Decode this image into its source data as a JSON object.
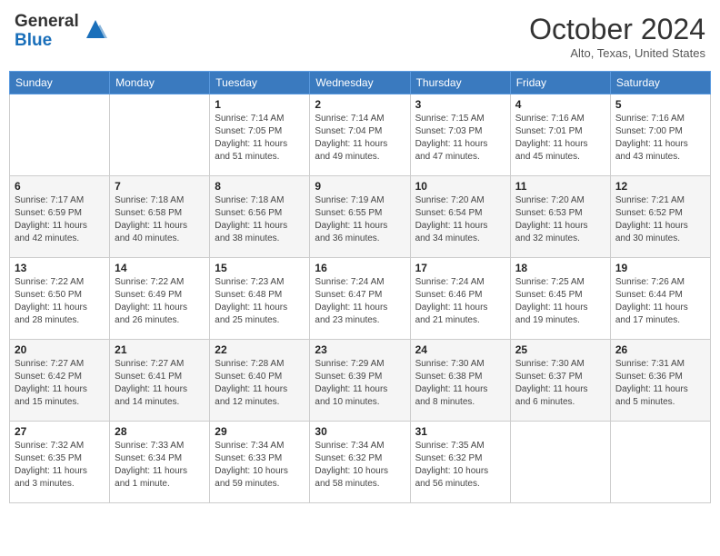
{
  "header": {
    "logo_line1": "General",
    "logo_line2": "Blue",
    "month": "October 2024",
    "location": "Alto, Texas, United States"
  },
  "weekdays": [
    "Sunday",
    "Monday",
    "Tuesday",
    "Wednesday",
    "Thursday",
    "Friday",
    "Saturday"
  ],
  "weeks": [
    [
      {
        "day": "",
        "sunrise": "",
        "sunset": "",
        "daylight": ""
      },
      {
        "day": "",
        "sunrise": "",
        "sunset": "",
        "daylight": ""
      },
      {
        "day": "1",
        "sunrise": "Sunrise: 7:14 AM",
        "sunset": "Sunset: 7:05 PM",
        "daylight": "Daylight: 11 hours and 51 minutes."
      },
      {
        "day": "2",
        "sunrise": "Sunrise: 7:14 AM",
        "sunset": "Sunset: 7:04 PM",
        "daylight": "Daylight: 11 hours and 49 minutes."
      },
      {
        "day": "3",
        "sunrise": "Sunrise: 7:15 AM",
        "sunset": "Sunset: 7:03 PM",
        "daylight": "Daylight: 11 hours and 47 minutes."
      },
      {
        "day": "4",
        "sunrise": "Sunrise: 7:16 AM",
        "sunset": "Sunset: 7:01 PM",
        "daylight": "Daylight: 11 hours and 45 minutes."
      },
      {
        "day": "5",
        "sunrise": "Sunrise: 7:16 AM",
        "sunset": "Sunset: 7:00 PM",
        "daylight": "Daylight: 11 hours and 43 minutes."
      }
    ],
    [
      {
        "day": "6",
        "sunrise": "Sunrise: 7:17 AM",
        "sunset": "Sunset: 6:59 PM",
        "daylight": "Daylight: 11 hours and 42 minutes."
      },
      {
        "day": "7",
        "sunrise": "Sunrise: 7:18 AM",
        "sunset": "Sunset: 6:58 PM",
        "daylight": "Daylight: 11 hours and 40 minutes."
      },
      {
        "day": "8",
        "sunrise": "Sunrise: 7:18 AM",
        "sunset": "Sunset: 6:56 PM",
        "daylight": "Daylight: 11 hours and 38 minutes."
      },
      {
        "day": "9",
        "sunrise": "Sunrise: 7:19 AM",
        "sunset": "Sunset: 6:55 PM",
        "daylight": "Daylight: 11 hours and 36 minutes."
      },
      {
        "day": "10",
        "sunrise": "Sunrise: 7:20 AM",
        "sunset": "Sunset: 6:54 PM",
        "daylight": "Daylight: 11 hours and 34 minutes."
      },
      {
        "day": "11",
        "sunrise": "Sunrise: 7:20 AM",
        "sunset": "Sunset: 6:53 PM",
        "daylight": "Daylight: 11 hours and 32 minutes."
      },
      {
        "day": "12",
        "sunrise": "Sunrise: 7:21 AM",
        "sunset": "Sunset: 6:52 PM",
        "daylight": "Daylight: 11 hours and 30 minutes."
      }
    ],
    [
      {
        "day": "13",
        "sunrise": "Sunrise: 7:22 AM",
        "sunset": "Sunset: 6:50 PM",
        "daylight": "Daylight: 11 hours and 28 minutes."
      },
      {
        "day": "14",
        "sunrise": "Sunrise: 7:22 AM",
        "sunset": "Sunset: 6:49 PM",
        "daylight": "Daylight: 11 hours and 26 minutes."
      },
      {
        "day": "15",
        "sunrise": "Sunrise: 7:23 AM",
        "sunset": "Sunset: 6:48 PM",
        "daylight": "Daylight: 11 hours and 25 minutes."
      },
      {
        "day": "16",
        "sunrise": "Sunrise: 7:24 AM",
        "sunset": "Sunset: 6:47 PM",
        "daylight": "Daylight: 11 hours and 23 minutes."
      },
      {
        "day": "17",
        "sunrise": "Sunrise: 7:24 AM",
        "sunset": "Sunset: 6:46 PM",
        "daylight": "Daylight: 11 hours and 21 minutes."
      },
      {
        "day": "18",
        "sunrise": "Sunrise: 7:25 AM",
        "sunset": "Sunset: 6:45 PM",
        "daylight": "Daylight: 11 hours and 19 minutes."
      },
      {
        "day": "19",
        "sunrise": "Sunrise: 7:26 AM",
        "sunset": "Sunset: 6:44 PM",
        "daylight": "Daylight: 11 hours and 17 minutes."
      }
    ],
    [
      {
        "day": "20",
        "sunrise": "Sunrise: 7:27 AM",
        "sunset": "Sunset: 6:42 PM",
        "daylight": "Daylight: 11 hours and 15 minutes."
      },
      {
        "day": "21",
        "sunrise": "Sunrise: 7:27 AM",
        "sunset": "Sunset: 6:41 PM",
        "daylight": "Daylight: 11 hours and 14 minutes."
      },
      {
        "day": "22",
        "sunrise": "Sunrise: 7:28 AM",
        "sunset": "Sunset: 6:40 PM",
        "daylight": "Daylight: 11 hours and 12 minutes."
      },
      {
        "day": "23",
        "sunrise": "Sunrise: 7:29 AM",
        "sunset": "Sunset: 6:39 PM",
        "daylight": "Daylight: 11 hours and 10 minutes."
      },
      {
        "day": "24",
        "sunrise": "Sunrise: 7:30 AM",
        "sunset": "Sunset: 6:38 PM",
        "daylight": "Daylight: 11 hours and 8 minutes."
      },
      {
        "day": "25",
        "sunrise": "Sunrise: 7:30 AM",
        "sunset": "Sunset: 6:37 PM",
        "daylight": "Daylight: 11 hours and 6 minutes."
      },
      {
        "day": "26",
        "sunrise": "Sunrise: 7:31 AM",
        "sunset": "Sunset: 6:36 PM",
        "daylight": "Daylight: 11 hours and 5 minutes."
      }
    ],
    [
      {
        "day": "27",
        "sunrise": "Sunrise: 7:32 AM",
        "sunset": "Sunset: 6:35 PM",
        "daylight": "Daylight: 11 hours and 3 minutes."
      },
      {
        "day": "28",
        "sunrise": "Sunrise: 7:33 AM",
        "sunset": "Sunset: 6:34 PM",
        "daylight": "Daylight: 11 hours and 1 minute."
      },
      {
        "day": "29",
        "sunrise": "Sunrise: 7:34 AM",
        "sunset": "Sunset: 6:33 PM",
        "daylight": "Daylight: 10 hours and 59 minutes."
      },
      {
        "day": "30",
        "sunrise": "Sunrise: 7:34 AM",
        "sunset": "Sunset: 6:32 PM",
        "daylight": "Daylight: 10 hours and 58 minutes."
      },
      {
        "day": "31",
        "sunrise": "Sunrise: 7:35 AM",
        "sunset": "Sunset: 6:32 PM",
        "daylight": "Daylight: 10 hours and 56 minutes."
      },
      {
        "day": "",
        "sunrise": "",
        "sunset": "",
        "daylight": ""
      },
      {
        "day": "",
        "sunrise": "",
        "sunset": "",
        "daylight": ""
      }
    ]
  ]
}
